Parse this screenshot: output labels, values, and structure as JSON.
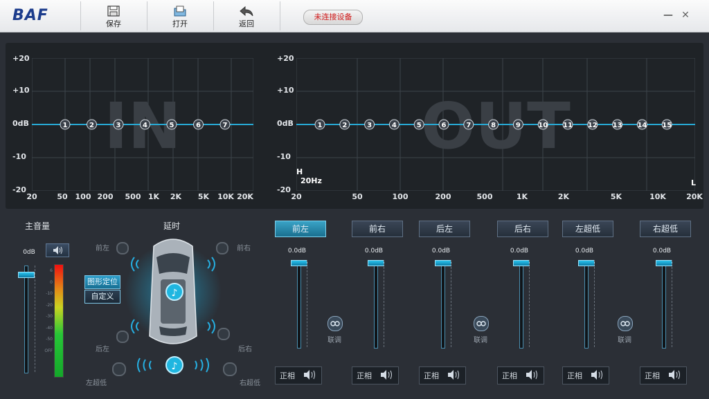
{
  "app": {
    "logo": "BAF"
  },
  "toolbar": {
    "save": "保存",
    "open": "打开",
    "back": "返回",
    "status": "未连接设备"
  },
  "eq_in": {
    "watermark": "IN",
    "y_labels": [
      "+20",
      "+10",
      "0dB",
      "-10",
      "-20"
    ],
    "x_labels": [
      "20",
      "50",
      "100",
      "200",
      "500",
      "1K",
      "2K",
      "5K",
      "10K",
      "20K"
    ],
    "bands": [
      "1",
      "2",
      "3",
      "4",
      "5",
      "6",
      "7"
    ]
  },
  "eq_out": {
    "watermark": "OUT",
    "y_labels": [
      "+20",
      "+10",
      "0dB",
      "-10",
      "-20"
    ],
    "x_labels": [
      "20",
      "50",
      "100",
      "200",
      "500",
      "1K",
      "2K",
      "5K",
      "10K",
      "20K"
    ],
    "bands": [
      "1",
      "2",
      "3",
      "4",
      "5",
      "6",
      "7",
      "8",
      "9",
      "10",
      "11",
      "12",
      "13",
      "14",
      "15"
    ],
    "hp_marker": "H",
    "hp_freq": "20Hz",
    "lp_marker": "L"
  },
  "master": {
    "title": "主音量",
    "value": "0dB",
    "meter_labels": [
      "6",
      "0",
      "-10",
      "-20",
      "-30",
      "-40",
      "-50",
      "OFF"
    ]
  },
  "delay": {
    "title": "延时",
    "graphic_btn": "图形定位",
    "custom_btn": "自定义",
    "spk_front_left": "前左",
    "spk_front_right": "前右",
    "spk_rear_left": "后左",
    "spk_rear_right": "后右",
    "spk_sub_left": "左超低",
    "spk_sub_right": "右超低"
  },
  "channels": [
    {
      "name": "前左",
      "value": "0.0dB",
      "phase": "正相"
    },
    {
      "name": "前右",
      "value": "0.0dB",
      "phase": "正相"
    },
    {
      "name": "后左",
      "value": "0.0dB",
      "phase": "正相"
    },
    {
      "name": "后右",
      "value": "0.0dB",
      "phase": "正相"
    },
    {
      "name": "左超低",
      "value": "0.0dB",
      "phase": "正相"
    },
    {
      "name": "右超低",
      "value": "0.0dB",
      "phase": "正相"
    }
  ],
  "link_label": "联调",
  "colors": {
    "accent": "#1fb6e0",
    "status_red": "#d01818",
    "panel": "#1f2327",
    "bg": "#2b2f36"
  }
}
